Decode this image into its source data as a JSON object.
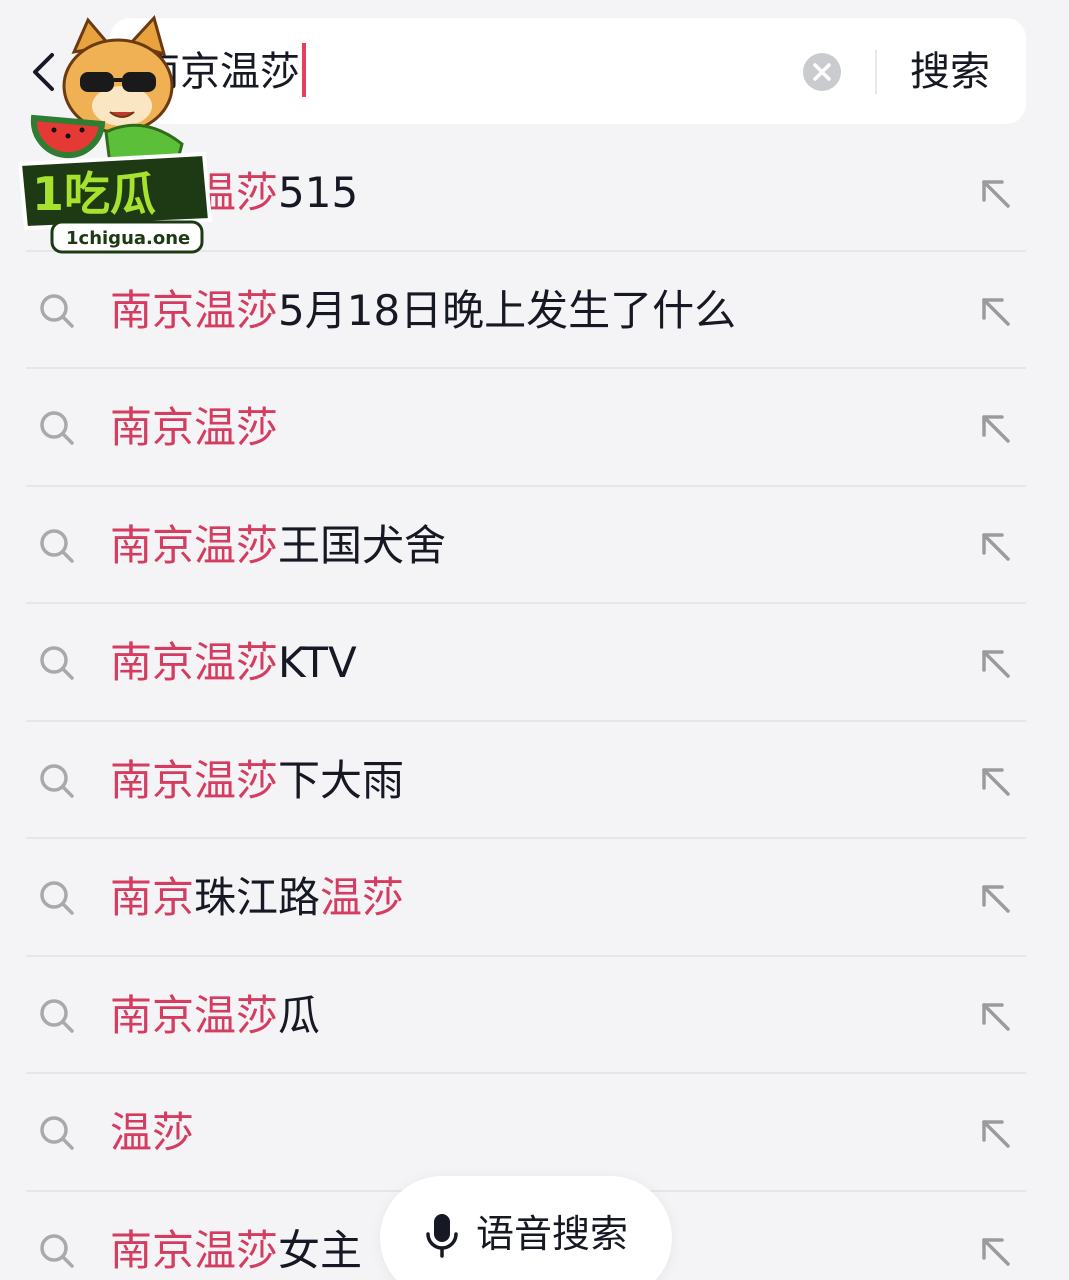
{
  "search": {
    "query": "南京温莎",
    "submit_label": "搜索"
  },
  "suggestions": [
    {
      "hl": "南京温莎",
      "rest": "515",
      "hl2": ""
    },
    {
      "hl": "南京温莎",
      "rest": "5月18日晚上发生了什么",
      "hl2": ""
    },
    {
      "hl": "南京温莎",
      "rest": "",
      "hl2": ""
    },
    {
      "hl": "南京温莎",
      "rest": "王国犬舍",
      "hl2": ""
    },
    {
      "hl": "南京温莎",
      "rest": "KTV",
      "hl2": ""
    },
    {
      "hl": "南京温莎",
      "rest": "下大雨",
      "hl2": ""
    },
    {
      "hl": "南京",
      "rest": "珠江路",
      "hl2": "温莎"
    },
    {
      "hl": "南京温莎",
      "rest": "瓜",
      "hl2": ""
    },
    {
      "hl": "温莎",
      "rest": "",
      "hl2": ""
    },
    {
      "hl": "南京温莎",
      "rest": "女主",
      "hl2": ""
    }
  ],
  "voice": {
    "label": "语音搜索"
  },
  "watermark": {
    "brand": "1吃瓜",
    "site": "1chigua.one"
  },
  "colors": {
    "highlight": "#d43d5f",
    "caret": "#e6405e",
    "text": "#161823",
    "background": "#f4f4f6"
  },
  "icons": {
    "back": "chevron-left-icon",
    "clear": "close-circle-icon",
    "row_leading": "search-icon",
    "row_trailing": "arrow-up-left-icon",
    "voice": "microphone-icon"
  }
}
